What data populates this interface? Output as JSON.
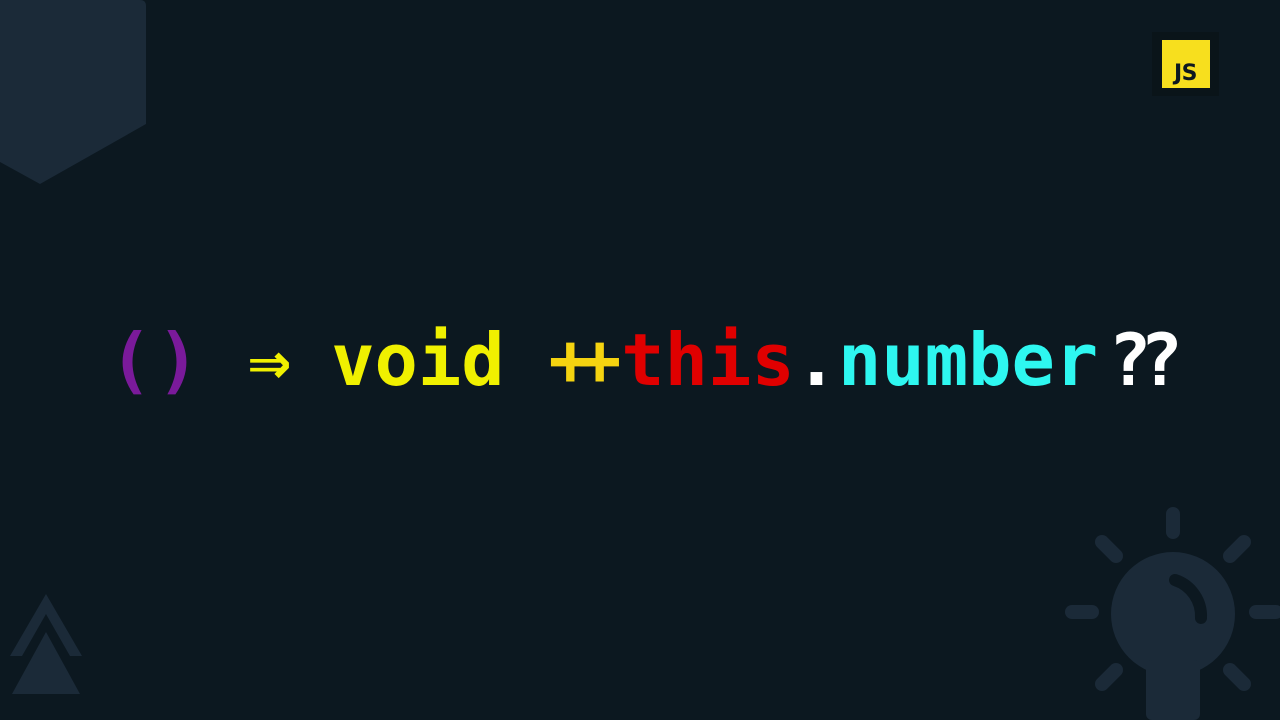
{
  "badge": {
    "label": "JS"
  },
  "code": {
    "parens": "()",
    "arrow": "⇒",
    "keyword_void": "void",
    "increment": "++",
    "keyword_this": "this",
    "dot": ".",
    "property": "number",
    "nullish": "??"
  },
  "colors": {
    "background": "#0c1820",
    "parens": "#7a1a9a",
    "arrow": "#f0f000",
    "void": "#f0f000",
    "increment": "#f5d310",
    "this": "#e00000",
    "dot": "#ffffff",
    "property": "#2ef7f0",
    "nullish": "#ffffff",
    "js_badge": "#f7df1e",
    "decoration": "#1b2a38"
  },
  "icons": [
    "bookmark-shape-icon",
    "js-logo-icon",
    "double-triangle-icon",
    "lightbulb-icon"
  ]
}
